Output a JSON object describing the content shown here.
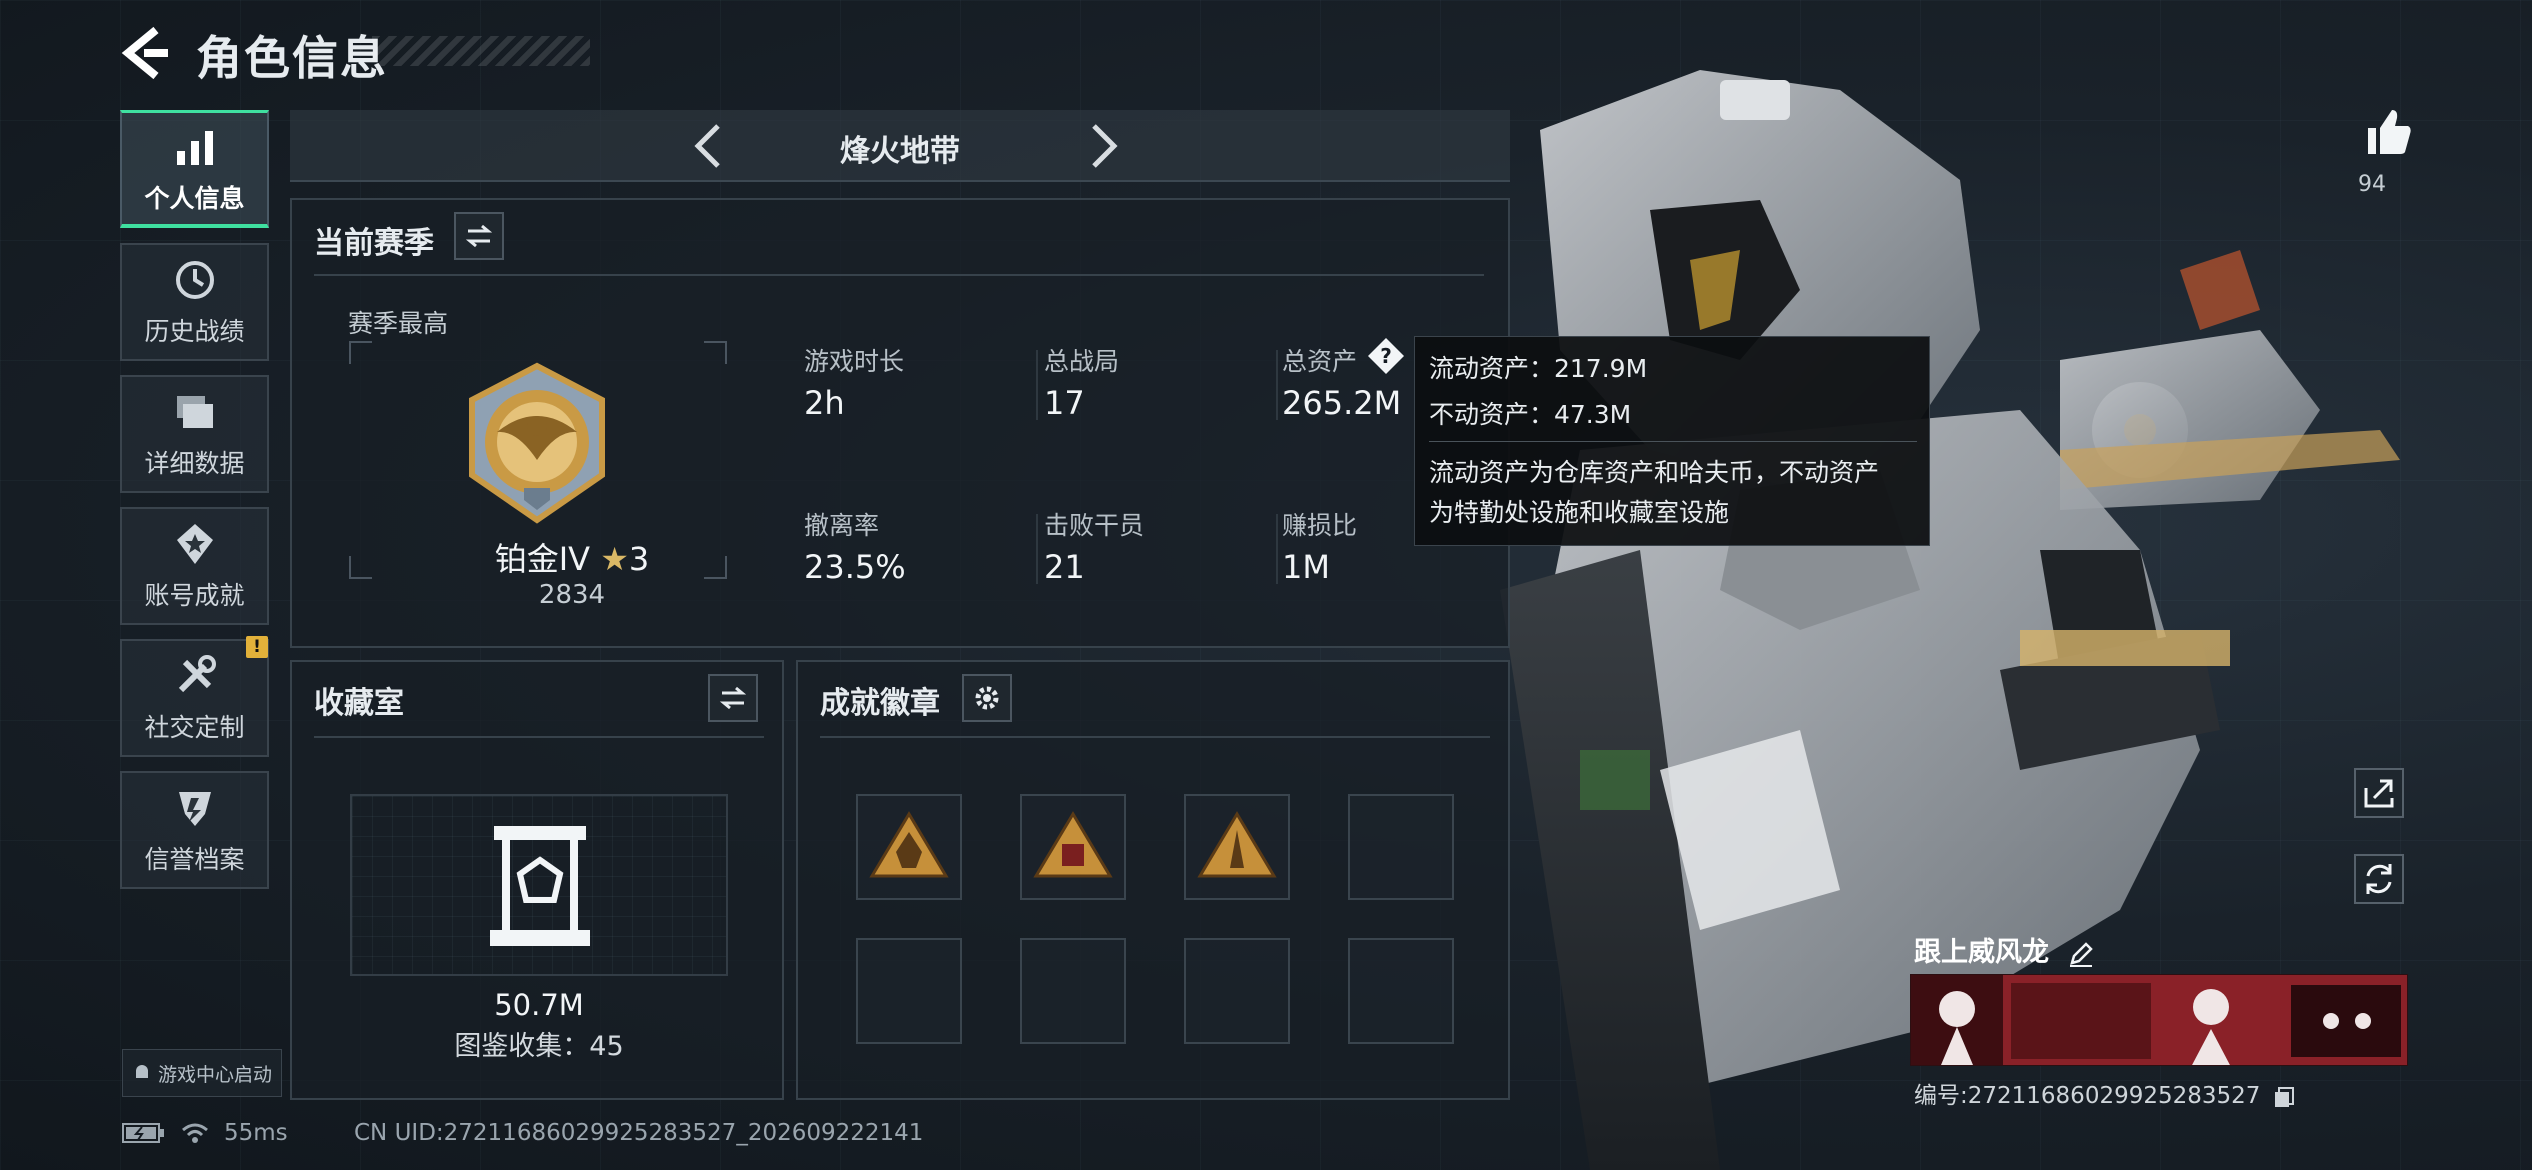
{
  "header": {
    "title": "角色信息"
  },
  "sidebar": {
    "items": [
      {
        "label": "个人信息",
        "icon": "bar-chart-icon",
        "active": true
      },
      {
        "label": "历史战绩",
        "icon": "clock-icon"
      },
      {
        "label": "详细数据",
        "icon": "folders-icon"
      },
      {
        "label": "账号成就",
        "icon": "achievement-icon"
      },
      {
        "label": "社交定制",
        "icon": "tools-icon",
        "badge": "!"
      },
      {
        "label": "信誉档案",
        "icon": "shield-icon"
      }
    ],
    "launch_label": "游戏中心启动"
  },
  "mode": {
    "title": "烽火地带"
  },
  "season": {
    "title": "当前赛季",
    "best_label": "赛季最高",
    "rank_name": "铂金IV",
    "rank_stars": "3",
    "rank_score": "2834",
    "stats": [
      {
        "label": "游戏时长",
        "value": "2h"
      },
      {
        "label": "总战局",
        "value": "17"
      },
      {
        "label": "总资产",
        "value": "265.2M"
      },
      {
        "label": "撤离率",
        "value": "23.5%"
      },
      {
        "label": "击败干员",
        "value": "21"
      },
      {
        "label": "赚损比",
        "value": "1M"
      }
    ]
  },
  "tooltip": {
    "liquid": "流动资产：217.9M",
    "fixed": "不动资产：47.3M",
    "desc_line1": "流动资产为仓库资产和哈夫币，不动资产",
    "desc_line2": "为特勤处设施和收藏室设施"
  },
  "collection": {
    "title": "收藏室",
    "value": "50.7M",
    "catalog": "图鉴收集：45"
  },
  "badges": {
    "title": "成就徽章"
  },
  "player": {
    "likes": "94",
    "name": "跟上威风龙",
    "id_text": "编号:27211686029925283527"
  },
  "status_bar": {
    "ping": "55ms",
    "uid": "CN UID:27211686029925283527_202609222141"
  },
  "colors": {
    "accent": "#3fe0a0",
    "warning": "#e2b13a",
    "gold": "#c99a45"
  }
}
